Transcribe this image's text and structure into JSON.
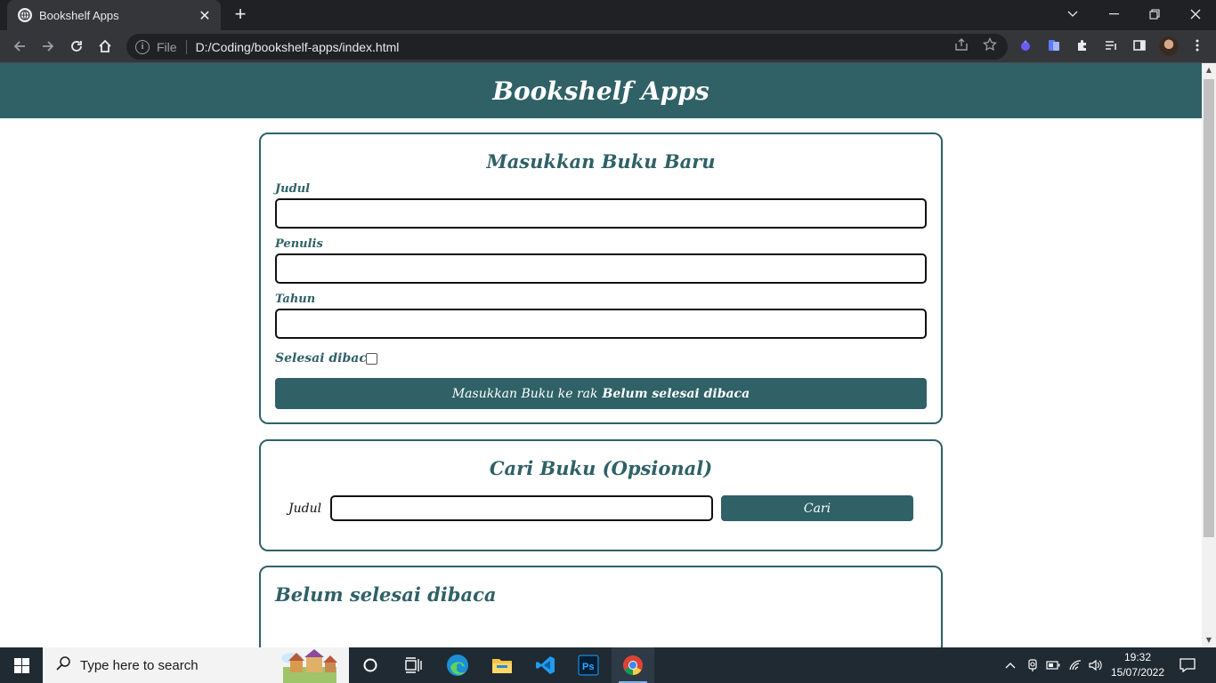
{
  "browser": {
    "tab_title": "Bookshelf Apps",
    "address_scheme_label": "File",
    "address_url": "D:/Coding/bookshelf-apps/index.html"
  },
  "page": {
    "app_title": "Bookshelf Apps",
    "input_section": {
      "title": "Masukkan Buku Baru",
      "title_label": "Judul",
      "title_value": "",
      "author_label": "Penulis",
      "author_value": "",
      "year_label": "Tahun",
      "year_value": "",
      "complete_label": "Selesai dibaca",
      "complete_checked": false,
      "submit_prefix": "Masukkan Buku ke rak",
      "submit_shelf": "Belum selesai dibaca"
    },
    "search_section": {
      "title": "Cari Buku (Opsional)",
      "title_label": "Judul",
      "title_value": "",
      "button_label": "Cari"
    },
    "incomplete_shelf": {
      "title": "Belum selesai dibaca"
    }
  },
  "taskbar": {
    "search_placeholder": "Type here to search",
    "time": "19:32",
    "date": "15/07/2022"
  },
  "colors": {
    "brand": "#2f6167",
    "browser_chrome": "#35363a",
    "taskbar": "#1f2a33"
  }
}
